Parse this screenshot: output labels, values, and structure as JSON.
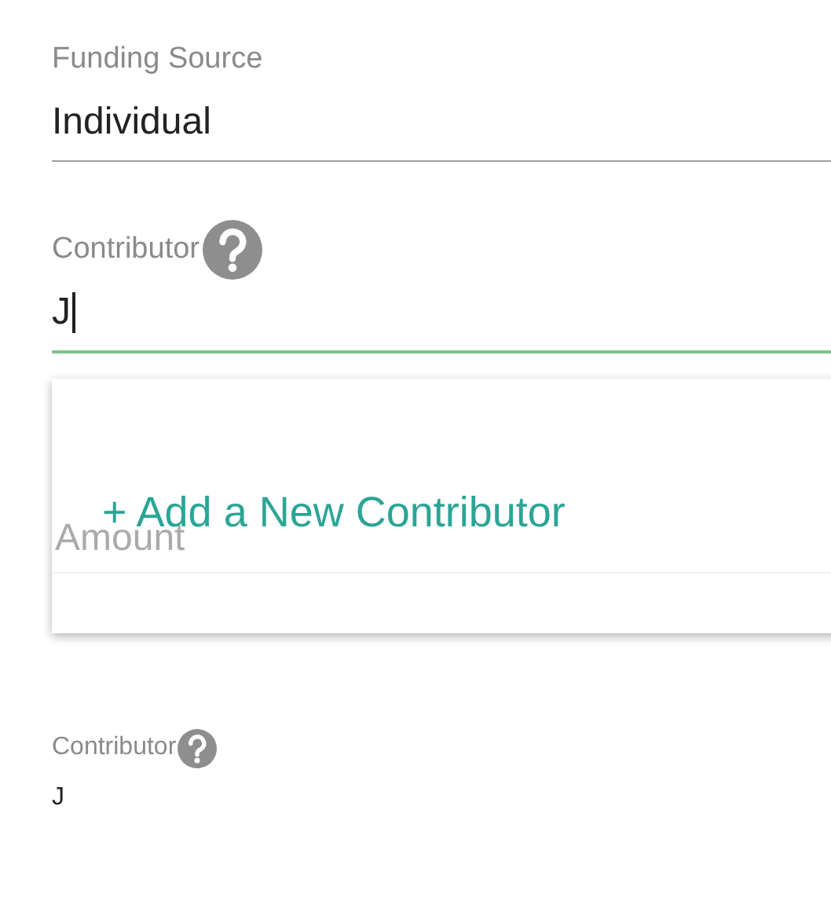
{
  "fields": [
    {
      "label": "Funding Source",
      "value": "Individual",
      "help": false,
      "focused": false
    },
    {
      "label": "Contributor",
      "value": "J",
      "help": true,
      "focused": true
    }
  ],
  "dropdown": {
    "options": [
      {
        "label": "+ Add a New Contributor"
      }
    ]
  },
  "covered_field": {
    "label": "Amount"
  },
  "summary": {
    "label": "Contributor",
    "value": "J",
    "help": true
  }
}
